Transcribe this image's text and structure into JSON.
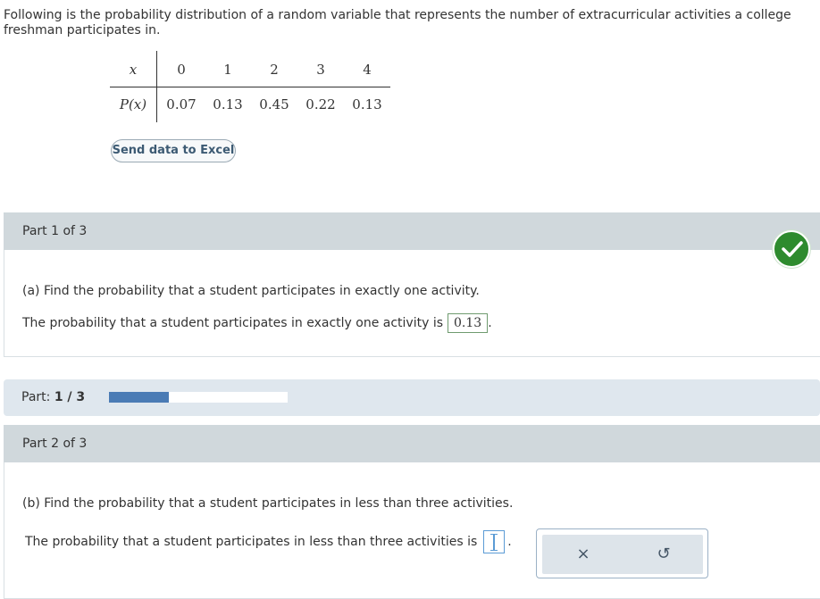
{
  "intro": "Following is the probability distribution of a random variable that represents the number of extracurricular activities a college freshman participates in.",
  "table": {
    "x_label": "x",
    "p_label": "P(x)",
    "x_values": [
      "0",
      "1",
      "2",
      "3",
      "4"
    ],
    "p_values": [
      "0.07",
      "0.13",
      "0.45",
      "0.22",
      "0.13"
    ]
  },
  "excel_button": "Send data to Excel",
  "part1": {
    "header": "Part 1 of 3",
    "question": "(a) Find the probability that a student participates in exactly one activity.",
    "answer_prefix": "The probability that a student participates in exactly one activity is",
    "answer_value": "0.13",
    "answer_suffix": "."
  },
  "progress": {
    "label": "Part:",
    "value": "1 / 3",
    "fraction": 0.333
  },
  "part2": {
    "header": "Part 2 of 3",
    "question": "(b) Find the probability that a student participates in less than three activities.",
    "answer_prefix": "The probability that a student participates in less than three activities is",
    "answer_suffix": "."
  },
  "toolbox": {
    "clear_icon": "×",
    "undo_icon": "↺"
  },
  "colors": {
    "check_green": "#2e8b2e",
    "progress_fill": "#4a7bb5",
    "part_header_bg": "#d0d8dc"
  }
}
